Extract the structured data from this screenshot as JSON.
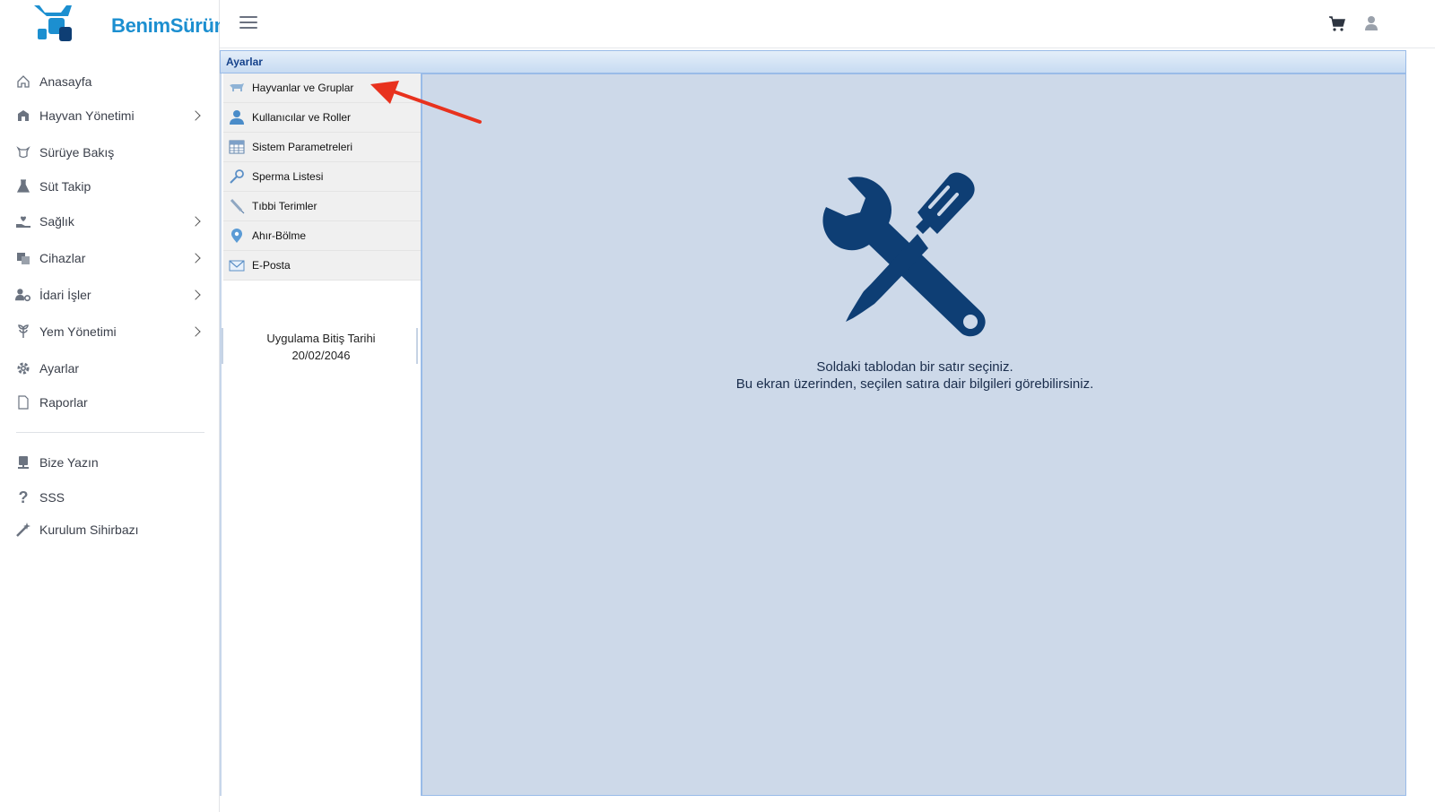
{
  "brand": {
    "name": "BenimSürüm"
  },
  "sidebar": {
    "items": [
      {
        "label": "Anasayfa",
        "icon": "home-icon",
        "has_submenu": false
      },
      {
        "label": "Hayvan Yönetimi",
        "icon": "barn-icon",
        "has_submenu": true
      },
      {
        "label": "Sürüye Bakış",
        "icon": "cow-icon",
        "has_submenu": false
      },
      {
        "label": "Süt Takip",
        "icon": "flask-icon",
        "has_submenu": false
      },
      {
        "label": "Sağlık",
        "icon": "hand-heart-icon",
        "has_submenu": true
      },
      {
        "label": "Cihazlar",
        "icon": "devices-icon",
        "has_submenu": true
      },
      {
        "label": "İdari İşler",
        "icon": "user-gear-icon",
        "has_submenu": true
      },
      {
        "label": "Yem Yönetimi",
        "icon": "feed-icon",
        "has_submenu": true
      },
      {
        "label": "Ayarlar",
        "icon": "gear-icon",
        "has_submenu": false
      },
      {
        "label": "Raporlar",
        "icon": "document-icon",
        "has_submenu": false
      }
    ],
    "secondary": [
      {
        "label": "Bize Yazın",
        "icon": "contact-icon"
      },
      {
        "label": "SSS",
        "icon": "question-icon"
      },
      {
        "label": "Kurulum Sihirbazı",
        "icon": "magic-wand-icon"
      }
    ]
  },
  "topbar": {
    "cart_icon": "cart-icon",
    "user_icon": "user-icon"
  },
  "panel": {
    "title": "Ayarlar"
  },
  "settings_menu": [
    {
      "label": "Hayvanlar ve Gruplar",
      "icon": "cow-small-icon"
    },
    {
      "label": "Kullanıcılar ve Roller",
      "icon": "user-blue-icon"
    },
    {
      "label": "Sistem Parametreleri",
      "icon": "table-icon"
    },
    {
      "label": "Sperma Listesi",
      "icon": "pipette-icon"
    },
    {
      "label": "Tıbbi Terimler",
      "icon": "syringe-icon"
    },
    {
      "label": "Ahır-Bölme",
      "icon": "map-pin-icon"
    },
    {
      "label": "E-Posta",
      "icon": "mail-icon"
    }
  ],
  "expiry": {
    "label": "Uygulama Bitiş Tarihi",
    "date": "20/02/2046"
  },
  "content": {
    "line1": "Soldaki tablodan bir satır seçiniz.",
    "line2": "Bu ekran üzerinden, seçilen satıra dair bilgileri görebilirsiniz."
  },
  "colors": {
    "brand": "#1c8fd0",
    "tool_icon": "#0e3e74",
    "content_bg": "#cdd9e9",
    "annotation_arrow": "#e8321e"
  }
}
